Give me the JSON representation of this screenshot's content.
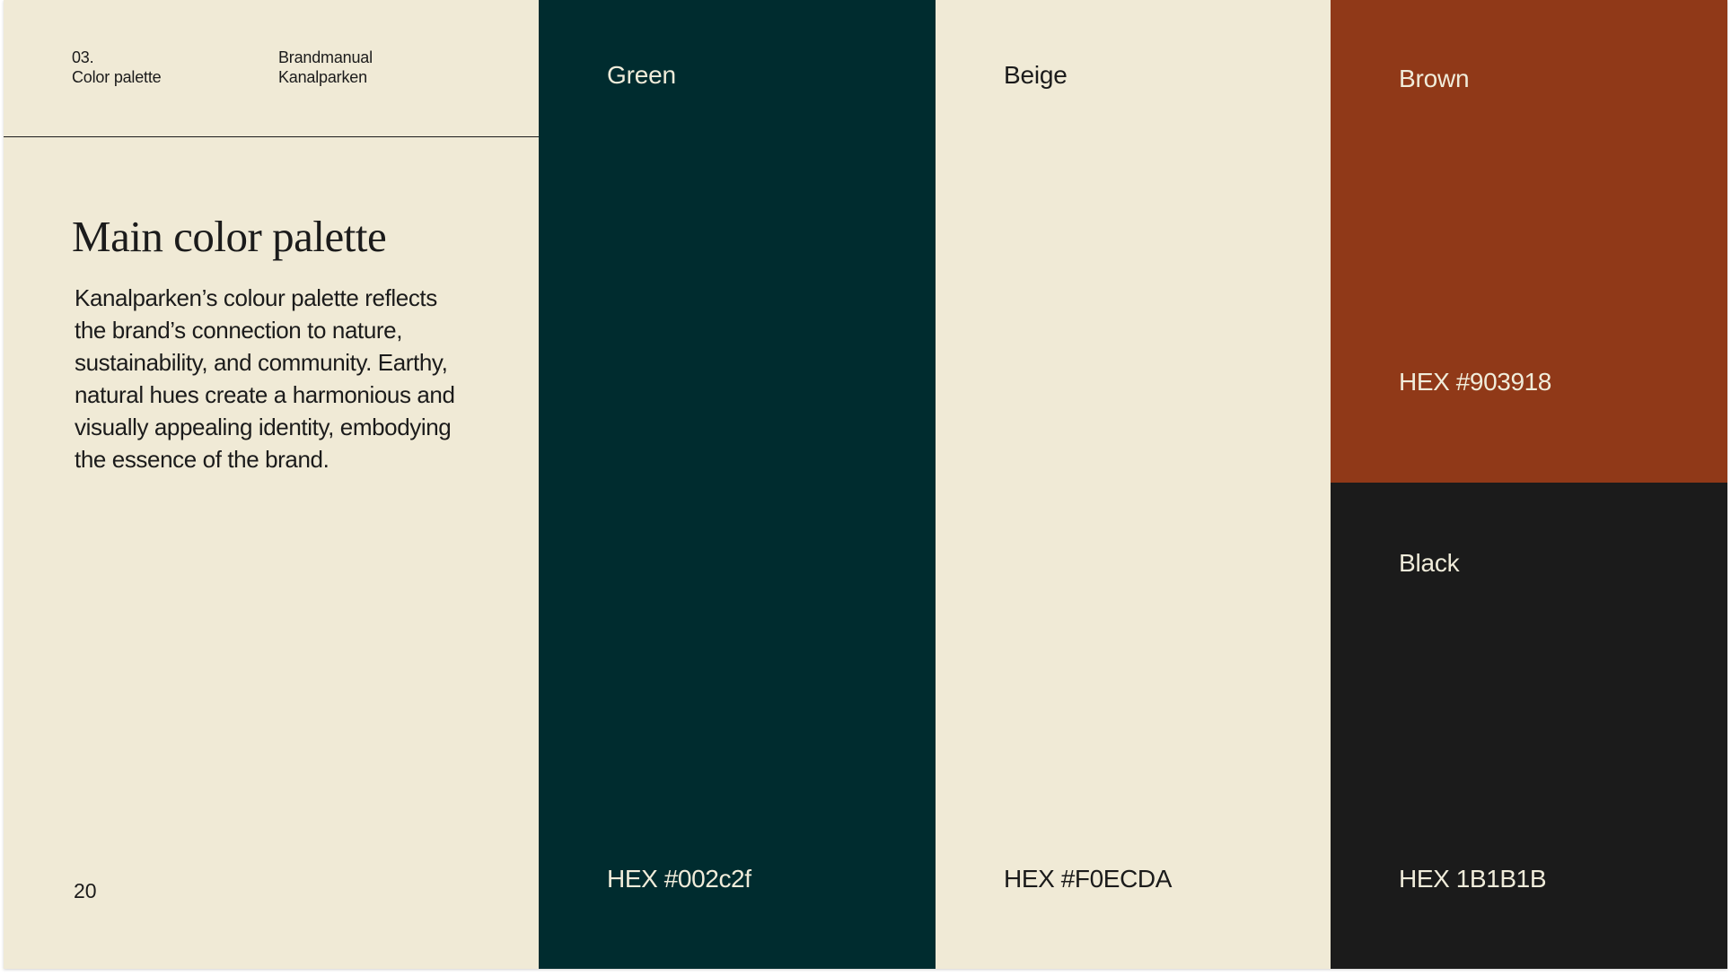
{
  "header": {
    "section_number": "03.",
    "section_title": "Color palette",
    "doc_name": "Brandmanual",
    "brand": "Kanalparken"
  },
  "intro": {
    "title": "Main color palette",
    "description": "Kanalparken’s colour palette reflects the brand’s connection to nature, sustainability, and community. Earthy, natural hues create a harmonious and visually appealing identity, embodying the essence of the brand.",
    "page_number": "20"
  },
  "swatches": [
    {
      "name": "Green",
      "hex_label": "HEX #002c2f",
      "color": "#002C2F",
      "text_color": "#F0ECDA"
    },
    {
      "name": "Beige",
      "hex_label": "HEX #F0ECDA",
      "color": "#F0EAD6",
      "text_color": "#1B1B1B"
    },
    {
      "name": "Brown",
      "hex_label": "HEX #903918",
      "color": "#903918",
      "text_color": "#F0ECDA"
    },
    {
      "name": "Black",
      "hex_label": "HEX 1B1B1B",
      "color": "#1B1B1B",
      "text_color": "#F0ECDA"
    }
  ]
}
